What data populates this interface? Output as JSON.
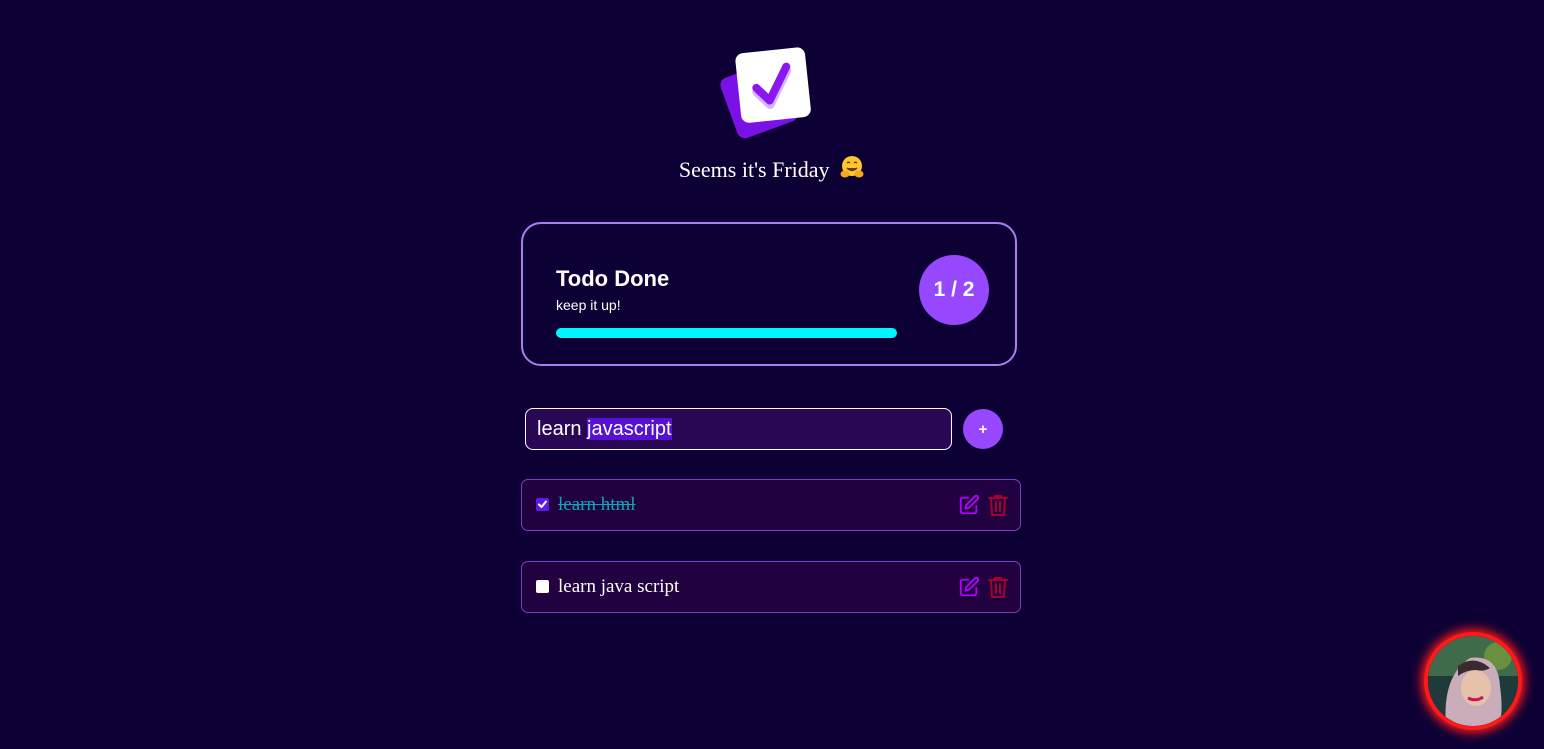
{
  "greeting": {
    "text": "Seems it's Friday",
    "emoji": "🤗"
  },
  "stats": {
    "title": "Todo Done",
    "subtitle": "keep it up!",
    "count_label": "1 / 2",
    "done": 1,
    "total": 2,
    "progress_fraction": 1.0
  },
  "input": {
    "value": "learn javascript",
    "value_unselected": "learn ",
    "value_selected": "javascript"
  },
  "add_button": {
    "label": "+"
  },
  "todos": [
    {
      "label": "learn html",
      "checked": true
    },
    {
      "label": "learn java script",
      "checked": false
    }
  ],
  "colors": {
    "background": "#0d0035",
    "accent": "#9748ff",
    "card_border": "#a97ef0",
    "progress": "#00f6ff",
    "done_text": "#0fa5b8",
    "edit_icon": "#b200ff",
    "delete_icon": "#a8002c",
    "avatar_ring": "#ff1a1a"
  },
  "icons": {
    "logo": "checkbox-logo-icon",
    "edit": "edit-icon",
    "delete": "trash-icon"
  }
}
